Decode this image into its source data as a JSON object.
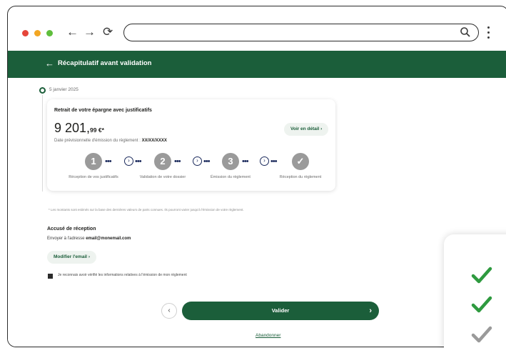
{
  "browser": {
    "url": "",
    "nav": {
      "back": "←",
      "forward": "→",
      "reload": "⟳"
    }
  },
  "header": {
    "back_glyph": "←",
    "title": "Récapitulatif avant validation"
  },
  "timeline": {
    "date": "5 janvier 2025"
  },
  "card": {
    "title": "Retrait de votre épargne avec justificatifs",
    "amount_int": "9 201,",
    "amount_dec": "99 €*",
    "emission_label": "Date prévisionnelle d'émission du règlement :",
    "emission_value": "XX/XX/XXXX",
    "detail_button": "Voir en détail",
    "detail_chevron": "›",
    "steps": [
      {
        "number": "1",
        "label": "Réception de vos justificatifs"
      },
      {
        "number": "2",
        "label": "Validation de votre dossier"
      },
      {
        "number": "3",
        "label": "Émission du règlement"
      },
      {
        "number": "✓",
        "label": "Réception du règlement"
      }
    ],
    "step_dots": "•••",
    "step_mid": "›"
  },
  "footnote": "* Les montants sont estimés sur la base des dernières valeurs de parts connues. Ils pourront varier jusqu'à l'émission de votre règlement.",
  "receipt": {
    "title": "Accusé de réception",
    "text": "Envoyer à l'adresse",
    "email": "email@monemail.com",
    "modify_button": "Modifier l'email",
    "modify_chevron": "›"
  },
  "confirm": {
    "label": "Je reconnais avoir vérifié les informations relatives à l'émission de mon règlement",
    "checked": true
  },
  "actions": {
    "prev": "‹",
    "validate": "Valider",
    "validate_chevron": "›",
    "abandon": "Abandonner"
  },
  "colors": {
    "brand_green": "#1b5e3a",
    "step_grey": "#9a9a9a",
    "check_green": "#2e9a3f",
    "check_grey": "#9a9a9a"
  },
  "side_panel": {
    "checks": [
      "check-green",
      "check-green",
      "check-grey"
    ]
  }
}
